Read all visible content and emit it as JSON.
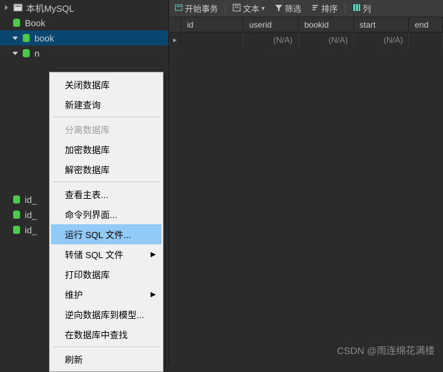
{
  "sidebar": {
    "items": [
      {
        "label": "本机MySQL",
        "icon": "connection"
      },
      {
        "label": "Book",
        "icon": "database-green"
      },
      {
        "label": "book",
        "icon": "database-green"
      },
      {
        "label": "n",
        "icon": "database-green"
      },
      {
        "label": "id_",
        "icon": "database-green"
      },
      {
        "label": "id_",
        "icon": "database-green"
      },
      {
        "label": "id_",
        "icon": "database-green"
      }
    ]
  },
  "toolbar": {
    "begin_trans": "开始事务",
    "text": "文本",
    "filter": "筛选",
    "sort": "排序",
    "columns": "列"
  },
  "table": {
    "columns": [
      "id",
      "userid",
      "bookid",
      "start",
      "end"
    ],
    "na": "(N/A)"
  },
  "context_menu": {
    "close_db": "关闭数据库",
    "new_query": "新建查询",
    "detach_db": "分离数据库",
    "encrypt_db": "加密数据库",
    "decrypt_db": "解密数据库",
    "view_main_table": "查看主表...",
    "cmd_interface": "命令列界面...",
    "run_sql": "运行 SQL 文件...",
    "dump_sql": "转储 SQL 文件",
    "print_db": "打印数据库",
    "maintain": "维护",
    "reverse_to_model": "逆向数据库到模型...",
    "find_in_db": "在数据库中查找",
    "refresh": "刷新"
  },
  "watermark": "CSDN @雨连绵花满楼"
}
